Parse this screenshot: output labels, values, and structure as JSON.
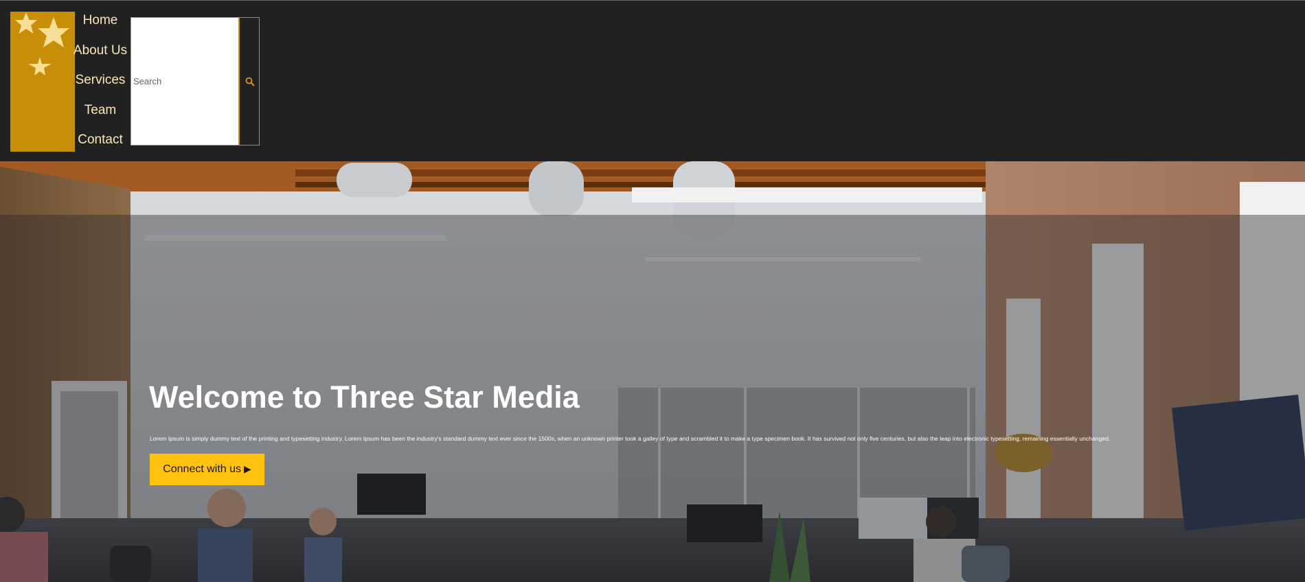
{
  "nav": {
    "items": [
      {
        "label": "Home"
      },
      {
        "label": "About Us"
      },
      {
        "label": "Services"
      },
      {
        "label": "Team"
      },
      {
        "label": "Contact"
      }
    ]
  },
  "search": {
    "placeholder": "Search",
    "value": ""
  },
  "hero": {
    "title": "Welcome to Three Star Media",
    "text": "Lorem Ipsum is simply dummy text of the printing and typesetting industry. Lorem Ipsum has been the industry's standard dummy text ever since the 1500s, when an unknown printer took a galley of type and scrambled it to make a type specimen book. It has survived not only five centuries, but also the leap into electronic typesetting, remaining essentially unchanged.",
    "cta_label": "Connect with us",
    "cta_arrow": "▶"
  },
  "colors": {
    "header_bg": "#212121",
    "logo_bg": "#c98e08",
    "nav_text": "#fce7b5",
    "accent": "#ffc20e"
  },
  "icons": {
    "logo": "three-stars-icon",
    "search": "search-icon"
  }
}
